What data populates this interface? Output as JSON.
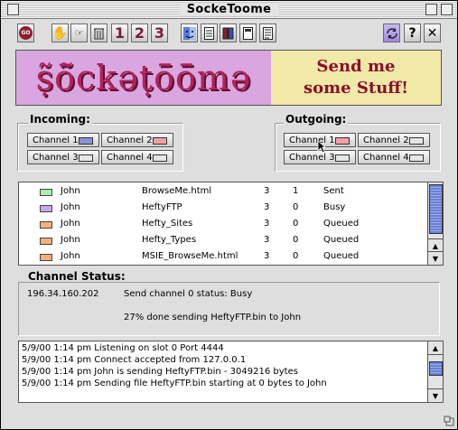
{
  "window": {
    "title": "SockeToome"
  },
  "toolbar": {
    "buttons": [
      {
        "icon": "go-icon",
        "label": "GO"
      },
      {
        "icon": "hand-icon"
      },
      {
        "icon": "hand-document-icon"
      },
      {
        "icon": "trash-icon"
      },
      {
        "icon": "number-1-icon",
        "label": "1"
      },
      {
        "icon": "number-2-icon",
        "label": "2"
      },
      {
        "icon": "number-3-icon",
        "label": "3"
      },
      {
        "icon": "finder-icon"
      },
      {
        "icon": "list-document-icon"
      },
      {
        "icon": "books-icon"
      },
      {
        "icon": "page-icon"
      },
      {
        "icon": "notes-icon"
      },
      {
        "icon": "sync-icon"
      },
      {
        "icon": "help-icon",
        "label": "?"
      },
      {
        "icon": "close-icon",
        "label": "✕"
      }
    ]
  },
  "banner": {
    "logo_text": "ṣ̃ō̃ckəṭō̄ō̄mə",
    "send_line1": "Send me",
    "send_line2": "some Stuff!"
  },
  "incoming": {
    "label": "Incoming:",
    "channels": [
      {
        "label": "Channel 1",
        "color": "#8a93d8"
      },
      {
        "label": "Channel 2",
        "color": "#f2a0a8"
      },
      {
        "label": "Channel 3",
        "color": "#e6e6e6"
      },
      {
        "label": "Channel 4",
        "color": "#e6e6e6"
      }
    ]
  },
  "outgoing": {
    "label": "Outgoing:",
    "channels": [
      {
        "label": "Channel 1",
        "color": "#f2a0a8"
      },
      {
        "label": "Channel 2",
        "color": "#e6e6e6"
      },
      {
        "label": "Channel 3",
        "color": "#e6e6e6"
      },
      {
        "label": "Channel 4",
        "color": "#e6e6e6"
      }
    ]
  },
  "transfers": {
    "rows": [
      {
        "color": "#a8f0b4",
        "user": "John",
        "file": "BrowseMe.html",
        "a": "3",
        "b": "1",
        "status": "Sent"
      },
      {
        "color": "#c8a8ec",
        "user": "John",
        "file": "HeftyFTP",
        "a": "3",
        "b": "0",
        "status": "Busy"
      },
      {
        "color": "#f5b07a",
        "user": "John",
        "file": "Hefty_Sites",
        "a": "3",
        "b": "0",
        "status": "Queued"
      },
      {
        "color": "#f5b07a",
        "user": "John",
        "file": "Hefty_Types",
        "a": "3",
        "b": "0",
        "status": "Queued"
      },
      {
        "color": "#f5b07a",
        "user": "John",
        "file": "MSIE_BrowseMe.html",
        "a": "3",
        "b": "0",
        "status": "Queued"
      }
    ]
  },
  "channel_status": {
    "label": "Channel Status:",
    "ip": "196.34.160.202",
    "message": "Send channel 0 status: Busy",
    "progress": "27% done sending HeftyFTP.bin to John"
  },
  "log": {
    "lines": [
      "5/9/00 1:14 pm Listening on slot 0 Port 4444",
      "5/9/00 1:14 pm Connect accepted from 127.0.0.1",
      "5/9/00 1:14 pm John is sending HeftyFTP.bin - 3049216 bytes",
      "5/9/00 1:14 pm Sending file HeftyFTP.bin starting at 0 bytes to John"
    ]
  }
}
